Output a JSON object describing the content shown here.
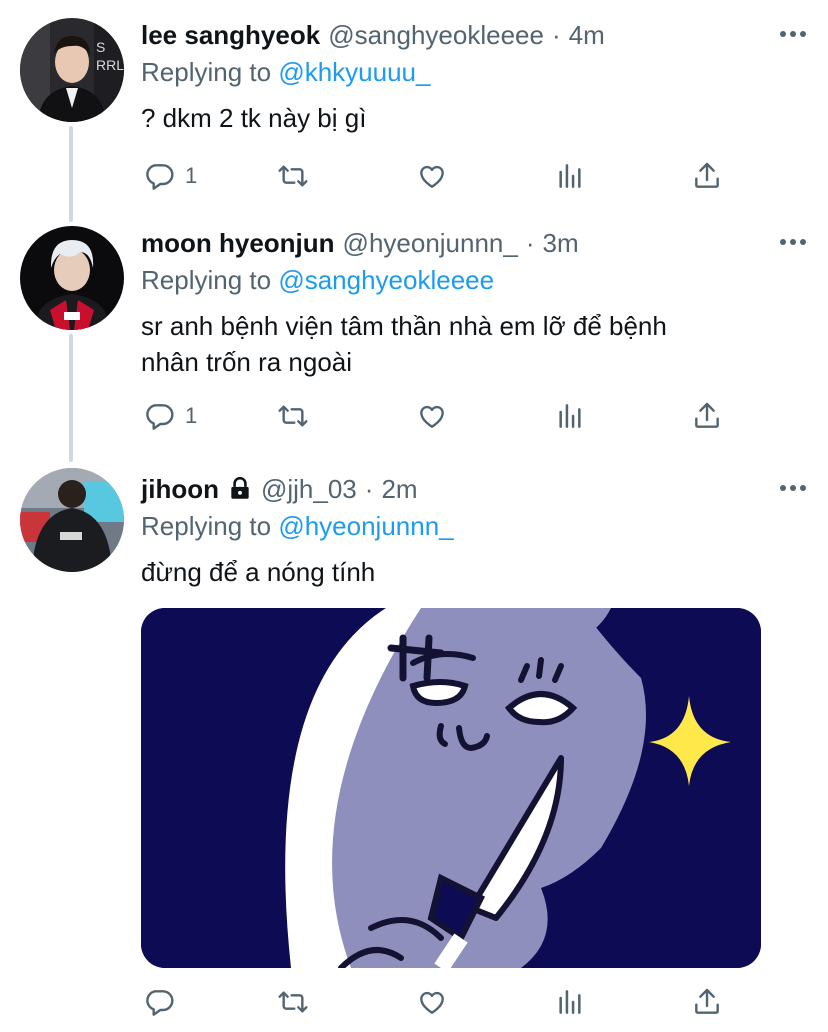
{
  "tweets": [
    {
      "name": "lee sanghyeok",
      "handle": "@sanghyeokleeee",
      "dot": "·",
      "time": "4m",
      "replying_prefix": "Replying to",
      "replying_to": "@khkyuuuu_",
      "text": "? dkm 2 tk này bị gì",
      "reply_count": "1",
      "locked": false
    },
    {
      "name": "moon hyeonjun",
      "handle": "@hyeonjunnn_",
      "dot": "·",
      "time": "3m",
      "replying_prefix": "Replying to",
      "replying_to": "@sanghyeokleeee",
      "text_line1": "sr anh bệnh viện tâm thần nhà em lỡ để bệnh",
      "text_line2": "nhân trốn ra ngoài",
      "reply_count": "1",
      "locked": false
    },
    {
      "name": "jihoon",
      "handle": "@jjh_03",
      "dot": "·",
      "time": "2m",
      "replying_prefix": "Replying to",
      "replying_to": "@hyeonjunnn_",
      "text": "đừng để a nóng tính",
      "reply_count": "",
      "locked": true,
      "media": "sticker-image"
    }
  ],
  "colors": {
    "link": "#1d9bf0",
    "secondary": "#536471",
    "thread_line": "#cfd9de",
    "sticker_background": "#0d0b53"
  },
  "icons": [
    "reply-icon",
    "retweet-icon",
    "like-icon",
    "analytics-icon",
    "share-icon",
    "more-icon",
    "lock-icon"
  ]
}
